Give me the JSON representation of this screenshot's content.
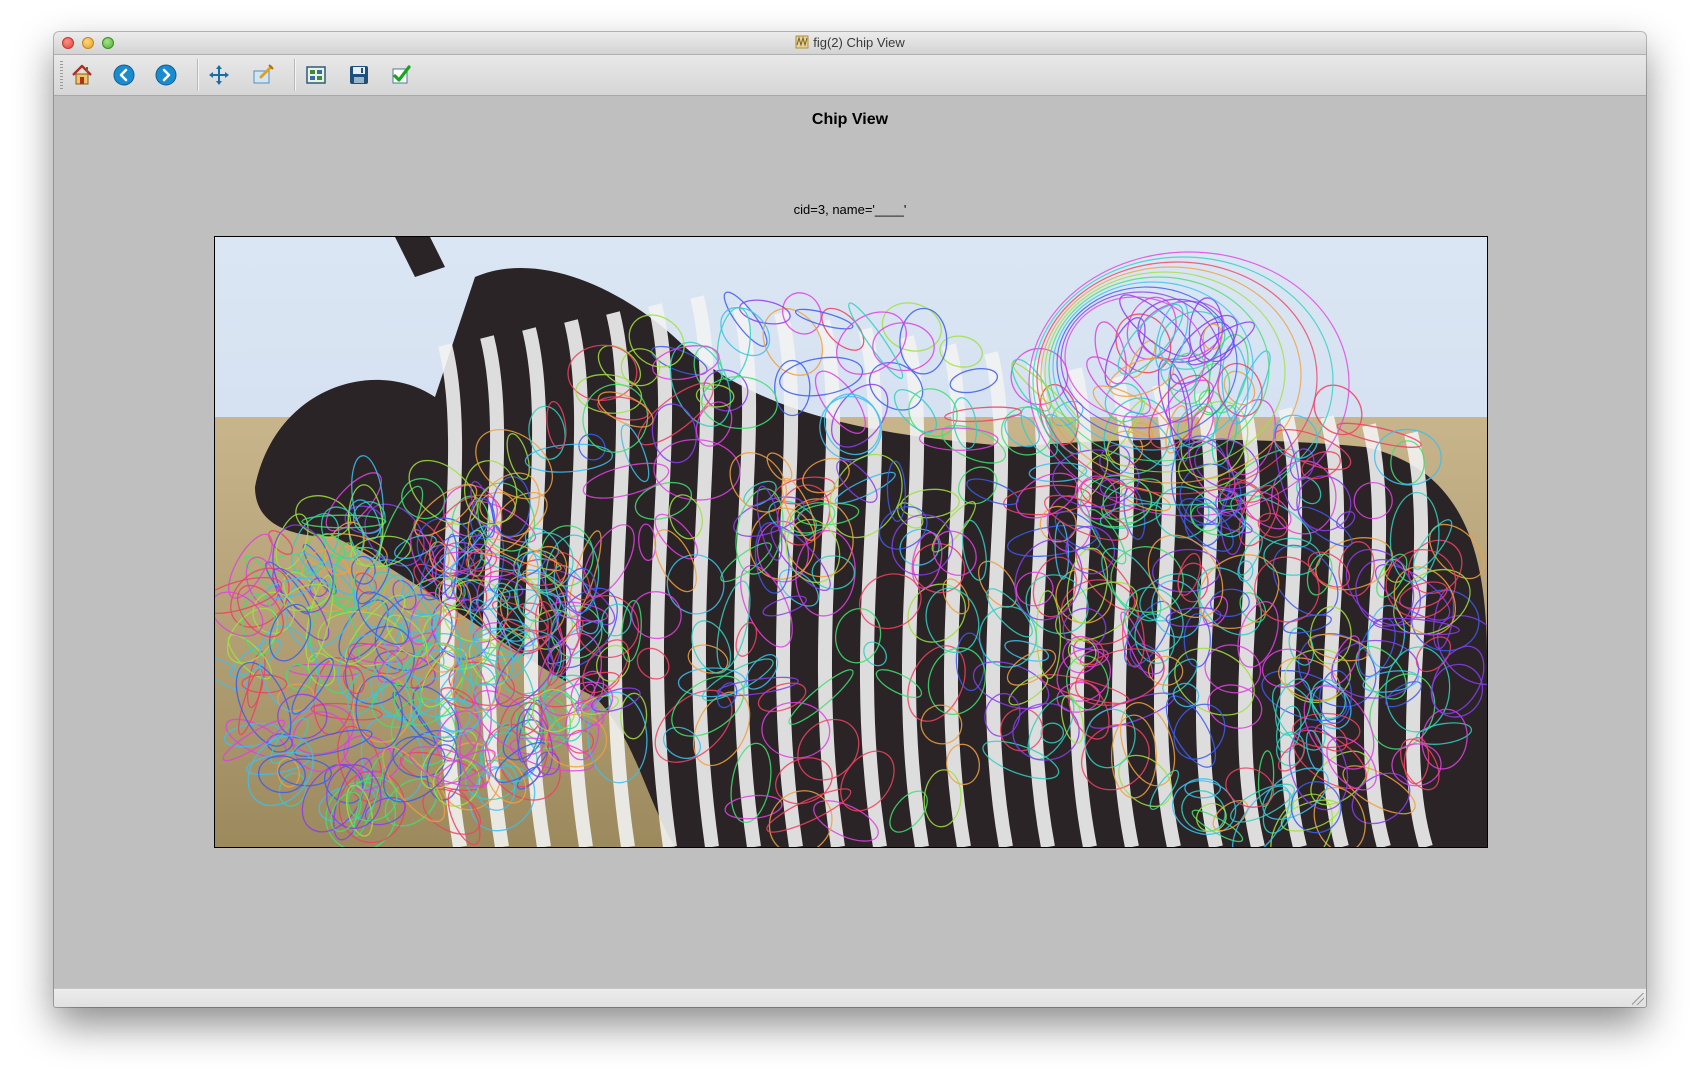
{
  "window": {
    "title": "fig(2) Chip View"
  },
  "toolbar": {
    "buttons": [
      {
        "name": "home-icon"
      },
      {
        "name": "back-icon"
      },
      {
        "name": "forward-icon"
      },
      {
        "name": "pan-icon"
      },
      {
        "name": "zoom-icon"
      },
      {
        "name": "configure-subplots-icon"
      },
      {
        "name": "save-icon"
      },
      {
        "name": "checkmark-icon"
      }
    ]
  },
  "figure": {
    "title": "Chip View",
    "axes_title": "cid=3, name='____'"
  },
  "colors": {
    "figure_background": "#bfbfbf",
    "sky": "#cfdcee",
    "grass": "#b8a37a",
    "ellipse_palette": [
      "#e040e0",
      "#8a3cf0",
      "#3c5cf0",
      "#3cc0f0",
      "#40e070",
      "#a0e040",
      "#f0a040",
      "#f04060",
      "#30d0c0"
    ]
  }
}
